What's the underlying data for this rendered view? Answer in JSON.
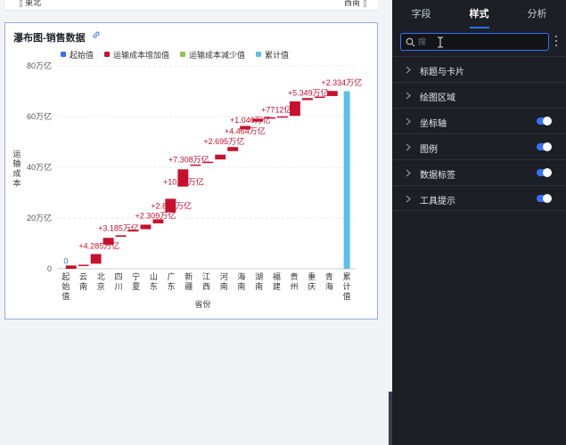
{
  "top_strip": {
    "left_label": "東北",
    "right_label": "西南"
  },
  "card": {
    "title": "瀑布图-销售数据"
  },
  "legend": [
    {
      "label": "起始值",
      "color": "#3370ff"
    },
    {
      "label": "运输成本增加值",
      "color": "#c8102e"
    },
    {
      "label": "运输成本减少值",
      "color": "#8bc34a"
    },
    {
      "label": "累计值",
      "color": "#5bc0eb"
    }
  ],
  "chart_data": {
    "type": "bar",
    "subtype": "waterfall",
    "xlabel": "省份",
    "ylabel": "运输成本",
    "ylim": [
      0,
      800000
    ],
    "y_ticks": [
      0,
      200000,
      400000,
      600000,
      800000
    ],
    "y_tick_labels": [
      "0",
      "20万亿",
      "40万亿",
      "60万亿",
      "80万亿"
    ],
    "grid": true,
    "categories": [
      "起始值",
      "云南",
      "北京",
      "四川",
      "宁夏",
      "山东",
      "广东",
      "新疆",
      "江西",
      "河南",
      "海南",
      "湖南",
      "福建",
      "贵州",
      "重庆",
      "青海",
      "累计值"
    ],
    "bars": [
      {
        "start": 0,
        "end": 0,
        "kind": "start"
      },
      {
        "start": 0,
        "end": 13000,
        "kind": "increase"
      },
      {
        "start": 13000,
        "end": 16000,
        "kind": "increase"
      },
      {
        "start": 20000,
        "end": 58000,
        "kind": "increase"
      },
      {
        "start": 95000,
        "end": 122000,
        "kind": "increase"
      },
      {
        "start": 126000,
        "end": 132000,
        "kind": "increase"
      },
      {
        "start": 147000,
        "end": 154000,
        "kind": "increase"
      },
      {
        "start": 156000,
        "end": 174000,
        "kind": "increase"
      },
      {
        "start": 179000,
        "end": 195000,
        "kind": "increase"
      },
      {
        "start": 223000,
        "end": 276000,
        "kind": "increase"
      },
      {
        "start": 324000,
        "end": 392000,
        "kind": "increase"
      },
      {
        "start": 408000,
        "end": 411000,
        "kind": "increase"
      },
      {
        "start": 418000,
        "end": 422000,
        "kind": "increase"
      },
      {
        "start": 431000,
        "end": 450000,
        "kind": "increase"
      },
      {
        "start": 464000,
        "end": 480000,
        "kind": "increase"
      },
      {
        "start": 549000,
        "end": 563000,
        "kind": "increase"
      },
      {
        "start": 580000,
        "end": 592000,
        "kind": "increase"
      },
      {
        "start": 594000,
        "end": 597000,
        "kind": "increase"
      },
      {
        "start": 598000,
        "end": 601000,
        "kind": "increase"
      },
      {
        "start": 603000,
        "end": 660000,
        "kind": "increase"
      },
      {
        "start": 665000,
        "end": 673000,
        "kind": "increase"
      },
      {
        "start": 677000,
        "end": 679000,
        "kind": "increase"
      },
      {
        "start": 681000,
        "end": 701000,
        "kind": "increase"
      },
      {
        "start": 0,
        "end": 700000,
        "kind": "total"
      }
    ],
    "data_labels": [
      {
        "text": "0",
        "value": 20000,
        "color": "#3370ff",
        "slot": 0
      },
      {
        "text": "+4.285万亿",
        "value": 79000,
        "slot": 1.9
      },
      {
        "text": "+3.185万亿",
        "value": 149000,
        "slot": 3.0
      },
      {
        "text": "+2.309万亿",
        "value": 198000,
        "slot": 5.1
      },
      {
        "text": "+2.862万亿",
        "value": 236000,
        "slot": 6.0
      },
      {
        "text": "+10.26万亿",
        "value": 332000,
        "slot": 6.7
      },
      {
        "text": "+7.308万亿",
        "value": 419000,
        "slot": 7.0
      },
      {
        "text": "+2.695万亿",
        "value": 492000,
        "slot": 9.0
      },
      {
        "text": "+4.464万亿",
        "value": 531000,
        "slot": 10.2
      },
      {
        "text": "+1.046万亿",
        "value": 575000,
        "slot": 10.5
      },
      {
        "text": "+7712亿",
        "value": 616000,
        "slot": 12.0
      },
      {
        "text": "+5.349万亿",
        "value": 682000,
        "slot": 13.8
      },
      {
        "text": "+2.334万亿",
        "value": 722000,
        "slot": 15.7
      }
    ]
  },
  "panel": {
    "tabs": [
      {
        "label": "字段",
        "active": false
      },
      {
        "label": "样式",
        "active": true
      },
      {
        "label": "分析",
        "active": false
      }
    ],
    "search_placeholder": "搜",
    "sections": [
      {
        "label": "标题与卡片",
        "toggle": false
      },
      {
        "label": "绘图区域",
        "toggle": false
      },
      {
        "label": "坐标轴",
        "toggle": true
      },
      {
        "label": "图例",
        "toggle": true
      },
      {
        "label": "数据标签",
        "toggle": true
      },
      {
        "label": "工具提示",
        "toggle": true
      }
    ]
  }
}
